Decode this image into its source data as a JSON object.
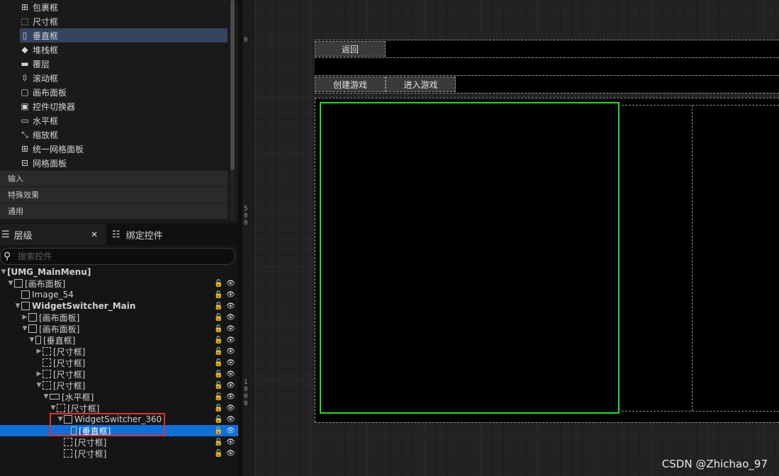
{
  "palette": {
    "items": [
      {
        "icon": "wrap-box-icon",
        "label": "包裹框",
        "selected": false
      },
      {
        "icon": "size-box-icon",
        "label": "尺寸框",
        "selected": false
      },
      {
        "icon": "vertical-box-icon",
        "label": "垂直框",
        "selected": true
      },
      {
        "icon": "stack-box-icon",
        "label": "堆栈框",
        "selected": false
      },
      {
        "icon": "overlay-icon",
        "label": "覆层",
        "selected": false
      },
      {
        "icon": "scroll-box-icon",
        "label": "滚动框",
        "selected": false
      },
      {
        "icon": "canvas-panel-icon",
        "label": "画布面板",
        "selected": false
      },
      {
        "icon": "widget-switcher-icon",
        "label": "控件切换器",
        "selected": false
      },
      {
        "icon": "horizontal-box-icon",
        "label": "水平框",
        "selected": false
      },
      {
        "icon": "scale-box-icon",
        "label": "缩放框",
        "selected": false
      },
      {
        "icon": "uniform-grid-icon",
        "label": "统一网格面板",
        "selected": false
      },
      {
        "icon": "grid-panel-icon",
        "label": "网格面板",
        "selected": false
      }
    ],
    "categories": [
      "输入",
      "特殊效果",
      "通用"
    ]
  },
  "hierarchy": {
    "tabs": [
      {
        "label": "层级",
        "active": true,
        "icon": "hierarchy-icon"
      },
      {
        "label": "绑定控件",
        "active": false,
        "icon": "bind-widgets-icon"
      }
    ],
    "search_placeholder": "搜索控件",
    "rows": [
      {
        "depth": 0,
        "arrow": "▼",
        "icon": "none",
        "label": "[UMG_MainMenu]",
        "bold": true,
        "selected": false,
        "has_controls": false
      },
      {
        "depth": 1,
        "arrow": "▼",
        "icon": "canvas",
        "label": "[画布面板]",
        "bold": false,
        "selected": false,
        "has_controls": true
      },
      {
        "depth": 2,
        "arrow": "",
        "icon": "image",
        "label": "Image_54",
        "bold": false,
        "selected": false,
        "has_controls": true
      },
      {
        "depth": 2,
        "arrow": "▼",
        "icon": "switcher",
        "label": "WidgetSwitcher_Main",
        "bold": true,
        "selected": false,
        "has_controls": true
      },
      {
        "depth": 3,
        "arrow": "▶",
        "icon": "canvas",
        "label": "[画布面板]",
        "bold": false,
        "selected": false,
        "has_controls": true
      },
      {
        "depth": 3,
        "arrow": "▼",
        "icon": "canvas",
        "label": "[画布面板]",
        "bold": false,
        "selected": false,
        "has_controls": true
      },
      {
        "depth": 4,
        "arrow": "▼",
        "icon": "vertical",
        "label": "[垂直框]",
        "bold": false,
        "selected": false,
        "has_controls": true
      },
      {
        "depth": 5,
        "arrow": "▶",
        "icon": "size",
        "label": "[尺寸框]",
        "bold": false,
        "selected": false,
        "has_controls": true
      },
      {
        "depth": 5,
        "arrow": "",
        "icon": "size",
        "label": "[尺寸框]",
        "bold": false,
        "selected": false,
        "has_controls": true
      },
      {
        "depth": 5,
        "arrow": "▶",
        "icon": "size",
        "label": "[尺寸框]",
        "bold": false,
        "selected": false,
        "has_controls": true
      },
      {
        "depth": 5,
        "arrow": "▼",
        "icon": "size",
        "label": "[尺寸框]",
        "bold": false,
        "selected": false,
        "has_controls": true
      },
      {
        "depth": 6,
        "arrow": "▼",
        "icon": "horizontal",
        "label": "[水平框]",
        "bold": false,
        "selected": false,
        "has_controls": true
      },
      {
        "depth": 7,
        "arrow": "▼",
        "icon": "size",
        "label": "[尺寸框]",
        "bold": false,
        "selected": false,
        "has_controls": true
      },
      {
        "depth": 8,
        "arrow": "▼",
        "icon": "switcher",
        "label": "WidgetSwitcher_360",
        "bold": false,
        "selected": false,
        "has_controls": true
      },
      {
        "depth": 9,
        "arrow": "",
        "icon": "vertical",
        "label": "[垂直框]",
        "bold": false,
        "selected": true,
        "has_controls": true
      },
      {
        "depth": 8,
        "arrow": "",
        "icon": "size",
        "label": "[尺寸框]",
        "bold": false,
        "selected": false,
        "has_controls": true
      },
      {
        "depth": 8,
        "arrow": "",
        "icon": "size",
        "label": "[尺寸框]",
        "bold": false,
        "selected": false,
        "has_controls": true
      }
    ]
  },
  "canvas": {
    "ruler_labels": [
      "0",
      "5\n0\n0",
      "1\n0\n0\n0"
    ],
    "buttons": {
      "back": "返回",
      "create_game": "创建游戏",
      "enter_game": "进入游戏"
    },
    "highlight_color": "#22e022",
    "watermark": "CSDN @Zhichao_97"
  },
  "colors": {
    "selection_blue": "#0e6fd8",
    "palette_selected": "#34445e",
    "annotation_red": "#e03030"
  }
}
